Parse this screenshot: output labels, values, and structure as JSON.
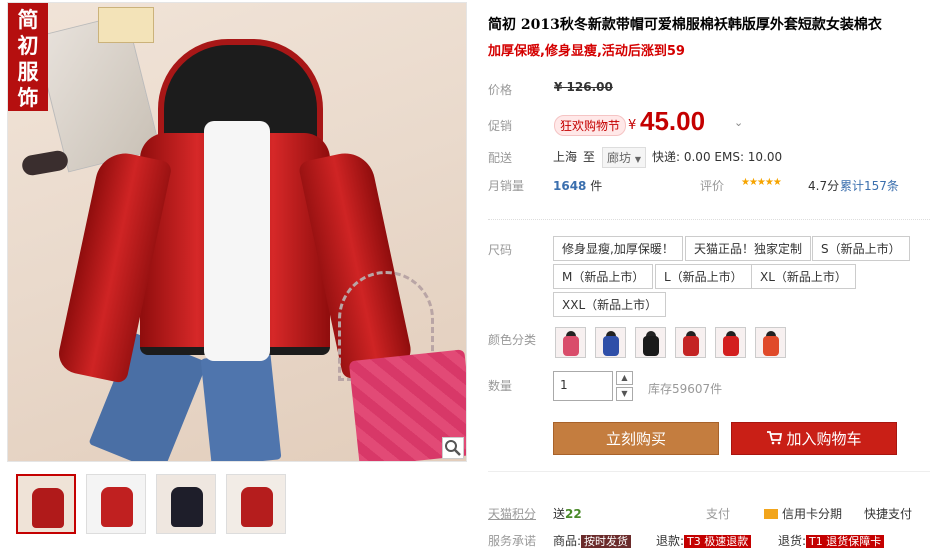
{
  "gallery": {
    "brand_badge": [
      "简",
      "初",
      "服",
      "饰"
    ],
    "thumbnails": [
      {
        "color": "#b01a1a"
      },
      {
        "color": "#c02020"
      },
      {
        "color": "#1e1e2a"
      },
      {
        "color": "#b51d1d"
      }
    ]
  },
  "product": {
    "title": "简初 2013秋冬新款带帽可爱棉服棉袄韩版厚外套短款女装棉衣",
    "subtitle": "加厚保暖,修身显瘦,活动后涨到59"
  },
  "price": {
    "label": "价格",
    "original": "¥ 126.00",
    "promo_label": "促销",
    "promo_tag": "狂欢购物节",
    "currency": "¥",
    "current": "45.00"
  },
  "shipping": {
    "label": "配送",
    "from": "上海",
    "to_word": "至",
    "destination": "廊坊",
    "fee": "快递: 0.00 EMS: 10.00"
  },
  "sales": {
    "label": "月销量",
    "count": "1648",
    "unit": "件",
    "rating_label": "评价",
    "stars": "★★★★★",
    "score": "4.7分",
    "total": "累计157条"
  },
  "size": {
    "label": "尺码",
    "options": [
      "修身显瘦,加厚保暖！",
      "天猫正品！独家定制",
      "S（新品上市）",
      "M（新品上市）",
      "L（新品上市）",
      "XL（新品上市）",
      "XXL（新品上市）"
    ]
  },
  "color": {
    "label": "颜色分类",
    "options": [
      {
        "color": "#d94d6b"
      },
      {
        "color": "#2f4fa8"
      },
      {
        "color": "#1a1a1a"
      },
      {
        "color": "#c42424"
      },
      {
        "color": "#d31f1f"
      },
      {
        "color": "#e04a2a"
      }
    ]
  },
  "quantity": {
    "label": "数量",
    "value": "1",
    "up": "▲",
    "down": "▼",
    "stock": "库存59607件"
  },
  "actions": {
    "buy_now": "立刻购买",
    "add_to_cart": "加入购物车",
    "cart_icon": "cart-icon"
  },
  "footer": {
    "points_label": "天猫积分",
    "points_prefix": "送",
    "points_value": "22",
    "pay_label": "支付",
    "credit_card": "信用卡分期",
    "quick_pay": "快捷支付",
    "service_label": "服务承诺",
    "goods_prefix": "商品:",
    "goods_tag": "按时发货",
    "refund_prefix": "退款:",
    "refund_tag": "T3 极速退款",
    "return_prefix": "退货:",
    "return_tag": "T1 退货保障卡"
  }
}
